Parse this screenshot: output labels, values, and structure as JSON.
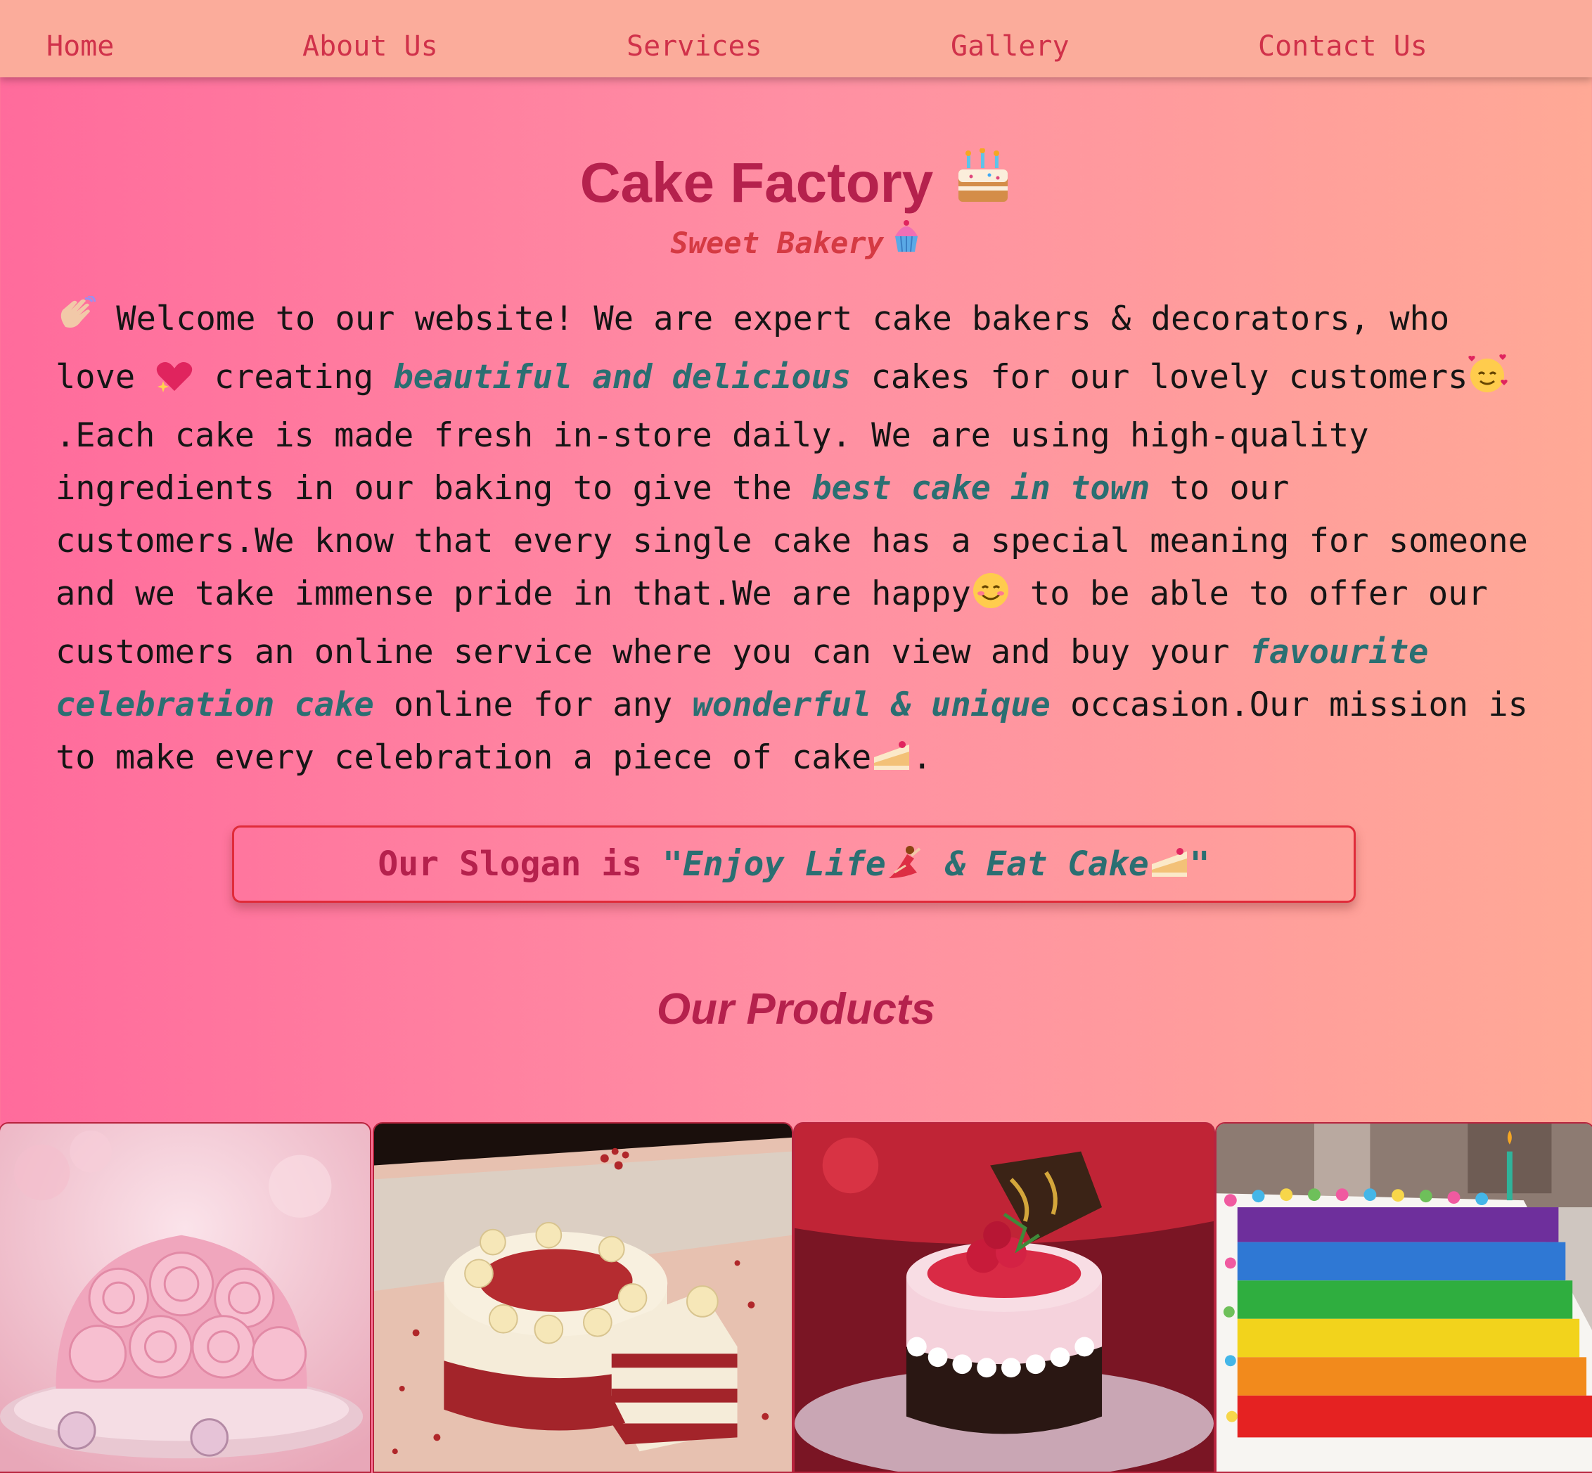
{
  "nav": {
    "items": [
      {
        "label": "Home"
      },
      {
        "label": "About Us"
      },
      {
        "label": "Services"
      },
      {
        "label": "Gallery"
      },
      {
        "label": "Contact Us"
      }
    ]
  },
  "header": {
    "title": "Cake Factory",
    "title_icon": "birthday-cake-icon",
    "subtitle": "Sweet Bakery",
    "subtitle_icon": "cupcake-icon"
  },
  "intro": {
    "p1": " Welcome to our website! We are expert cake bakers & decorators, who love ",
    "p2": " creating ",
    "h1": "beautiful and delicious",
    "p3": " cakes for our lovely customers",
    "p4": ".Each cake is made fresh in-store daily. We are using high-quality ingredients in our baking to give the ",
    "h2": "best cake in town",
    "p5": " to our customers.We know that every single cake has a special meaning for someone and we take immense pride in that.We are happy",
    "p6": " to be able to offer our customers an online service where you can view and buy your ",
    "h3": "favourite celebration cake",
    "p7": " online for any ",
    "h4": "wonderful & unique",
    "p8": " occasion.Our mission is to make every celebration a piece of cake",
    "p9": "."
  },
  "slogan": {
    "prefix": "Our Slogan is ",
    "quote_open": "\"Enjoy Life",
    "quote_mid": " & Eat Cake",
    "quote_close": "\""
  },
  "products": {
    "heading": "Our Products",
    "items": [
      {
        "name": "pink rose cake"
      },
      {
        "name": "red velvet cake"
      },
      {
        "name": "raspberry mousse cake"
      },
      {
        "name": "rainbow layer cake"
      }
    ]
  },
  "colors": {
    "nav_bg": "#fbac9b",
    "nav_text": "#d0314a",
    "title": "#b5214d",
    "highlight": "#2a6f72",
    "border": "#e02b3a"
  }
}
